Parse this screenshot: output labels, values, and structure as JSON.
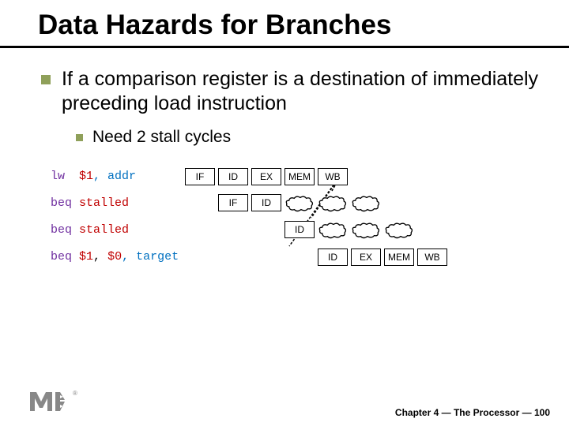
{
  "title": "Data Hazards for Branches",
  "main_bullet": "If a comparison register is a destination of immediately preceding load instruction",
  "sub_bullet": "Need 2 stall cycles",
  "instructions": {
    "r0": {
      "op": "lw",
      "reg": "$1",
      "rest": ", addr"
    },
    "r1": {
      "op": "beq",
      "label": "stalled"
    },
    "r2": {
      "op": "beq",
      "label": "stalled"
    },
    "r3": {
      "op": "beq",
      "reg1": "$1",
      "reg2": "$0",
      "rest": ", target"
    }
  },
  "stages": {
    "if": "IF",
    "id": "ID",
    "ex": "EX",
    "mem": "MEM",
    "wb": "WB"
  },
  "footer": {
    "chapter": "Chapter 4 — The Processor — 100"
  }
}
